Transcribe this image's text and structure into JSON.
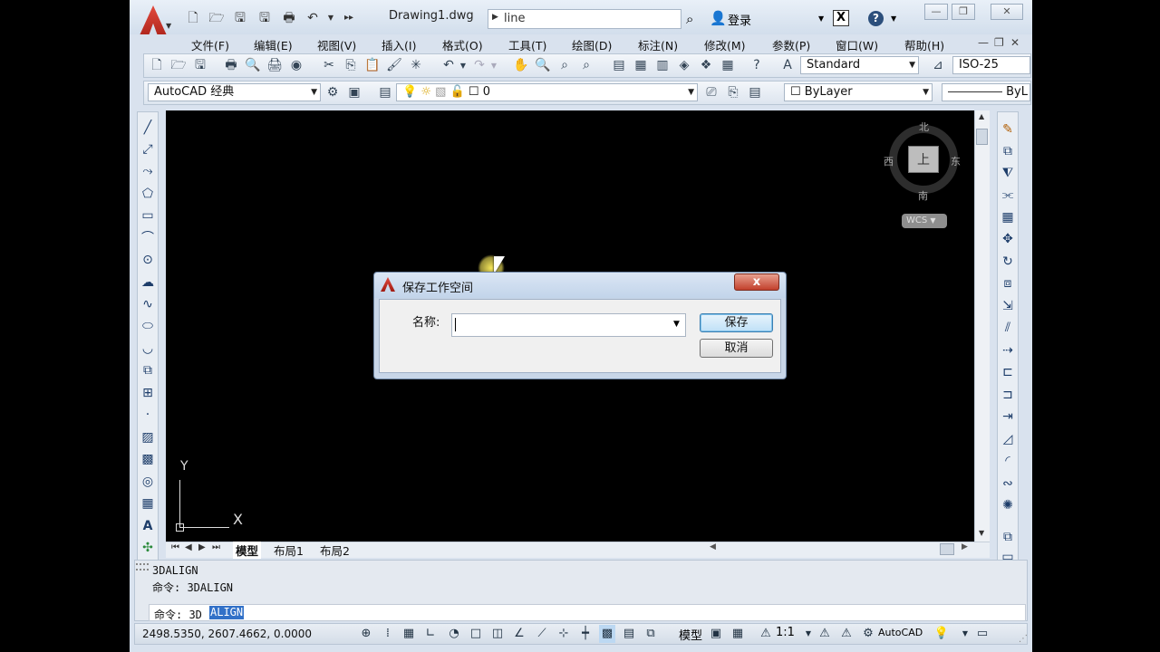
{
  "window": {
    "title": "Drawing1.dwg",
    "search_value": "line",
    "login_label": "登录",
    "controls": [
      "minimize-window",
      "maximize-window",
      "close-window"
    ]
  },
  "menu": {
    "items": [
      "文件(F)",
      "编辑(E)",
      "视图(V)",
      "插入(I)",
      "格式(O)",
      "工具(T)",
      "绘图(D)",
      "标注(N)",
      "修改(M)",
      "参数(P)",
      "窗口(W)",
      "帮助(H)"
    ]
  },
  "toolbar": {
    "text_style": "Standard",
    "dim_style": "ISO-25",
    "workspace": "AutoCAD 经典",
    "layer": "0",
    "color": "ByLayer",
    "linetype": "ByL"
  },
  "viewcube": {
    "north": "北",
    "south": "南",
    "east": "东",
    "west": "西",
    "top": "上",
    "wcs": "WCS"
  },
  "ucs": {
    "x": "X",
    "y": "Y"
  },
  "tabs": [
    "模型",
    "布局1",
    "布局2"
  ],
  "dialog": {
    "title": "保存工作空间",
    "name_label": "名称:",
    "name_value": "",
    "save_label": "保存",
    "cancel_label": "取消",
    "close_label": "x"
  },
  "command": {
    "history": [
      "3DALIGN",
      "命令: 3DALIGN"
    ],
    "prompt": "命令: 3D",
    "selected": "ALIGN"
  },
  "status": {
    "coordinates": "2498.5350, 2607.4662, 0.0000",
    "model_label": "模型",
    "scale": "1:1",
    "workspace": "AutoCAD"
  },
  "colors": {
    "canvas": "#000000",
    "chrome": "#d9e2ee",
    "highlight": "#3271c8",
    "close_button": "#c2402c"
  }
}
